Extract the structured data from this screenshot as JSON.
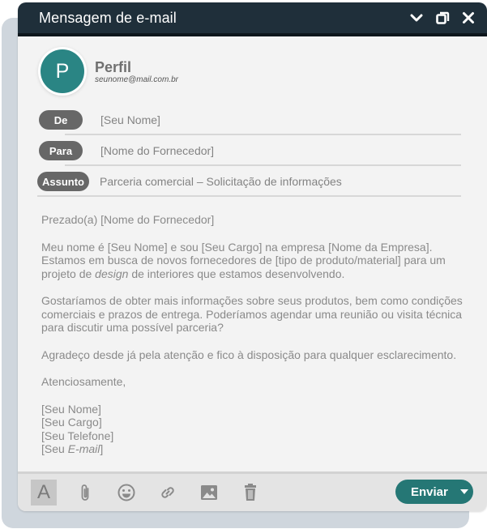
{
  "window": {
    "title": "Mensagem de e-mail"
  },
  "profile": {
    "initial": "P",
    "name": "Perfil",
    "email": "seunome@mail.com.br"
  },
  "fields": {
    "from": {
      "label": "De",
      "value": "[Seu Nome]"
    },
    "to": {
      "label": "Para",
      "value": "[Nome do Fornecedor]"
    },
    "subject": {
      "label": "Assunto",
      "value": "Parceria comercial – Solicitação de informações"
    }
  },
  "body": {
    "greeting": "Prezado(a) [Nome do Fornecedor]",
    "p1_a": "Meu nome é [Seu Nome] e sou [Seu Cargo] na empresa [Nome da Empresa]. Estamos em busca de novos fornecedores de [tipo de produto/material] para um projeto de ",
    "p1_em": "design",
    "p1_b": " de interiores que estamos desenvolvendo.",
    "p2": "Gostaríamos de obter mais informações sobre seus produtos, bem como condições comerciais e prazos de entrega. Poderíamos agendar uma reunião ou visita técnica para discutir uma possível parceria?",
    "p3": "Agradeço desde já pela atenção e fico à disposição para qualquer esclarecimento.",
    "closing": "Atenciosamente,",
    "sig_name": "[Seu Nome]",
    "sig_role": "[Seu Cargo]",
    "sig_phone": "[Seu Telefone]",
    "sig_email_a": "[Seu ",
    "sig_email_em": "E-mail",
    "sig_email_b": "]"
  },
  "toolbar": {
    "format_glyph": "A",
    "send_label": "Enviar",
    "icons": [
      "text-format-icon",
      "attachment-icon",
      "emoji-icon",
      "link-icon",
      "image-icon",
      "trash-icon",
      "chevron-down-icon"
    ]
  },
  "colors": {
    "titlebar": "#1f2f3a",
    "accent": "#257775",
    "avatar": "#2a8584",
    "pill": "#676767"
  }
}
